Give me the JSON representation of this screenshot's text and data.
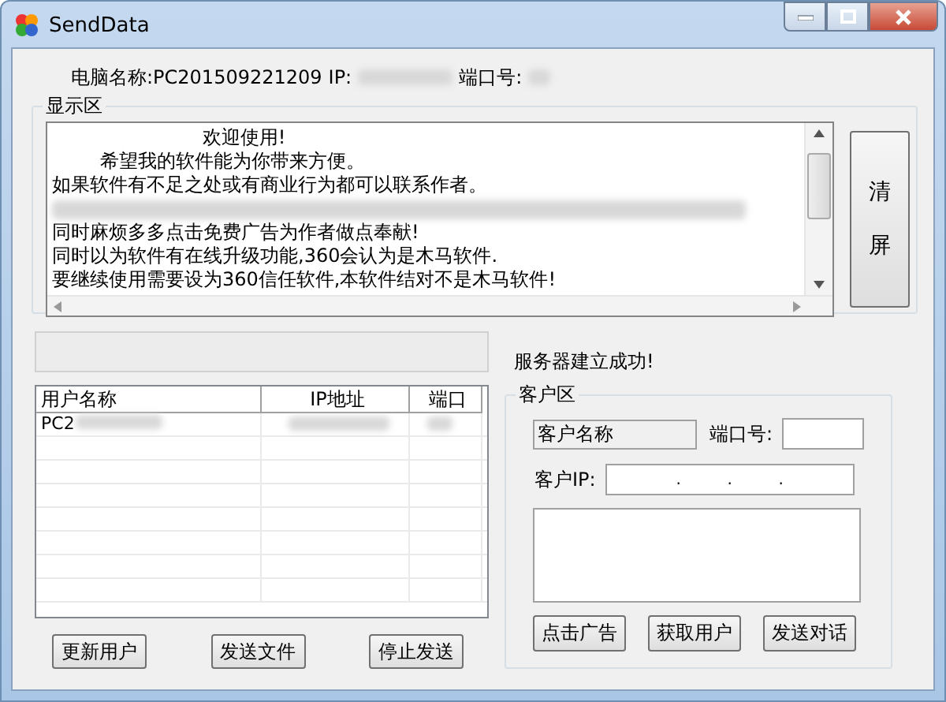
{
  "window": {
    "title": "SendData"
  },
  "info": {
    "computer_name": "电脑名称:PC201509221209",
    "ip_label": "IP:",
    "port_label": "端口号:"
  },
  "display": {
    "title": "显示区",
    "lines": [
      {
        "kind": "text",
        "text": "                         欢迎使用!"
      },
      {
        "kind": "text",
        "text": "        希望我的软件能为你带来方便。"
      },
      {
        "kind": "text",
        "text": "如果软件有不足之处或有商业行为都可以联系作者。"
      },
      {
        "kind": "redacted"
      },
      {
        "kind": "text",
        "text": "同时麻烦多多点击免费广告为作者做点奉献!"
      },
      {
        "kind": "text",
        "text": "同时以为软件有在线升级功能,360会认为是木马软件."
      },
      {
        "kind": "text",
        "text": "要继续使用需要设为360信任软件,本软件结对不是木马软件!"
      }
    ],
    "clear_button": "清屏"
  },
  "status_message": "服务器建立成功!",
  "user_table": {
    "columns": [
      "用户名称",
      "IP地址",
      "端口"
    ],
    "rows": [
      {
        "name": "PC2"
      }
    ]
  },
  "buttons": [
    "更新用户",
    "发送文件",
    "停止发送"
  ],
  "client_area": {
    "title": "客户区",
    "name_field": "客户名称",
    "port_label": "端口号:",
    "ip_label": "客户IP:",
    "ip_separators": [
      ".",
      ".",
      "."
    ],
    "buttons": [
      "点击广告",
      "获取用户",
      "发送对话"
    ]
  }
}
